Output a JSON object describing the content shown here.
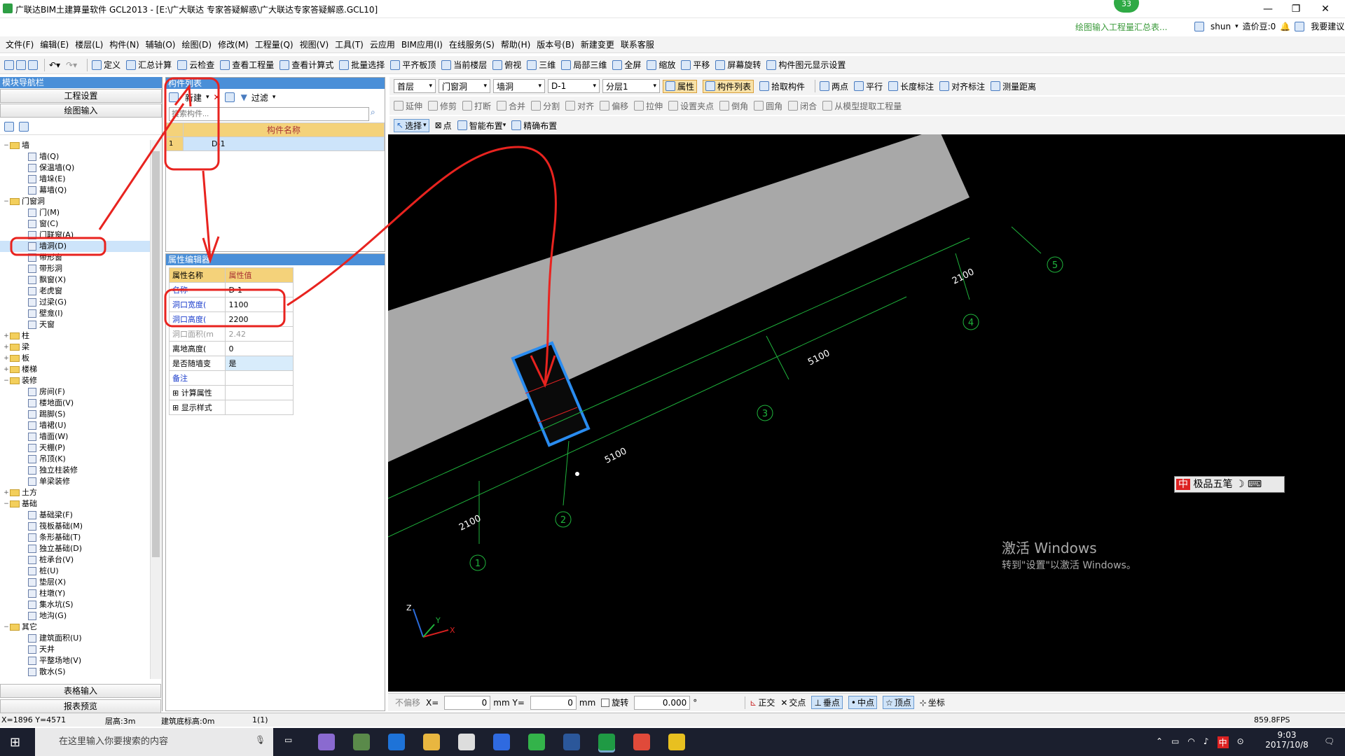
{
  "window": {
    "title": "广联达BIM土建算量软件 GCL2013 - [E:\\广大联达   专家答疑解惑\\广大联达专家答疑解惑.GCL10]",
    "notify_count": "33",
    "notify_text": "绘图输入工程量汇总表...",
    "user": "shun",
    "price_bean": "造价豆:0",
    "feedback": "我要建议"
  },
  "menu": [
    "文件(F)",
    "编辑(E)",
    "楼层(L)",
    "构件(N)",
    "辅轴(O)",
    "绘图(D)",
    "修改(M)",
    "工程量(Q)",
    "视图(V)",
    "工具(T)",
    "云应用",
    "BIM应用(I)",
    "在线服务(S)",
    "帮助(H)",
    "版本号(B)",
    "新建变更",
    "联系客服"
  ],
  "toolbar1": [
    "定义",
    "汇总计算",
    "云检查",
    "查看工程量",
    "查看计算式",
    "批量选择",
    "平齐板顶",
    "当前楼层",
    "俯视",
    "三维",
    "局部三维",
    "全屏",
    "缩放",
    "平移",
    "屏幕旋转",
    "构件图元显示设置"
  ],
  "nav": {
    "title": "模块导航栏",
    "btn_project": "工程设置",
    "btn_draw": "绘图输入",
    "btn_table": "表格输入",
    "btn_report": "报表预览",
    "tree": [
      {
        "label": "墙",
        "level": 0,
        "folder": true,
        "tog": "−"
      },
      {
        "label": "墙(Q)",
        "level": 1
      },
      {
        "label": "保温墙(Q)",
        "level": 1
      },
      {
        "label": "墙垛(E)",
        "level": 1
      },
      {
        "label": "幕墙(Q)",
        "level": 1
      },
      {
        "label": "门窗洞",
        "level": 0,
        "folder": true,
        "tog": "−"
      },
      {
        "label": "门(M)",
        "level": 1
      },
      {
        "label": "窗(C)",
        "level": 1
      },
      {
        "label": "门联窗(A)",
        "level": 1
      },
      {
        "label": "墙洞(D)",
        "level": 1
      },
      {
        "label": "带形窗",
        "level": 1
      },
      {
        "label": "带形洞",
        "level": 1
      },
      {
        "label": "飘窗(X)",
        "level": 1
      },
      {
        "label": "老虎窗",
        "level": 1
      },
      {
        "label": "过梁(G)",
        "level": 1
      },
      {
        "label": "壁龛(I)",
        "level": 1
      },
      {
        "label": "天窗",
        "level": 1
      },
      {
        "label": "柱",
        "level": 0,
        "folder": true,
        "tog": "+"
      },
      {
        "label": "梁",
        "level": 0,
        "folder": true,
        "tog": "+"
      },
      {
        "label": "板",
        "level": 0,
        "folder": true,
        "tog": "+"
      },
      {
        "label": "楼梯",
        "level": 0,
        "folder": true,
        "tog": "+"
      },
      {
        "label": "装修",
        "level": 0,
        "folder": true,
        "tog": "−"
      },
      {
        "label": "房间(F)",
        "level": 1
      },
      {
        "label": "楼地面(V)",
        "level": 1
      },
      {
        "label": "踢脚(S)",
        "level": 1
      },
      {
        "label": "墙裙(U)",
        "level": 1
      },
      {
        "label": "墙面(W)",
        "level": 1
      },
      {
        "label": "天棚(P)",
        "level": 1
      },
      {
        "label": "吊顶(K)",
        "level": 1
      },
      {
        "label": "独立柱装修",
        "level": 1
      },
      {
        "label": "单梁装修",
        "level": 1
      },
      {
        "label": "土方",
        "level": 0,
        "folder": true,
        "tog": "+"
      },
      {
        "label": "基础",
        "level": 0,
        "folder": true,
        "tog": "−"
      },
      {
        "label": "基础梁(F)",
        "level": 1
      },
      {
        "label": "筏板基础(M)",
        "level": 1
      },
      {
        "label": "条形基础(T)",
        "level": 1
      },
      {
        "label": "独立基础(D)",
        "level": 1
      },
      {
        "label": "桩承台(V)",
        "level": 1
      },
      {
        "label": "桩(U)",
        "level": 1
      },
      {
        "label": "垫层(X)",
        "level": 1
      },
      {
        "label": "柱墩(Y)",
        "level": 1
      },
      {
        "label": "集水坑(S)",
        "level": 1
      },
      {
        "label": "地沟(G)",
        "level": 1
      },
      {
        "label": "其它",
        "level": 0,
        "folder": true,
        "tog": "−"
      },
      {
        "label": "建筑面积(U)",
        "level": 1
      },
      {
        "label": "天井",
        "level": 1
      },
      {
        "label": "平整场地(V)",
        "level": 1
      },
      {
        "label": "散水(S)",
        "level": 1
      }
    ]
  },
  "complist": {
    "title": "构件列表",
    "new_btn": "新建",
    "filter_btn": "过滤",
    "search_placeholder": "搜索构件...",
    "col_name": "构件名称",
    "rows": [
      {
        "idx": "1",
        "name": "D-1"
      }
    ]
  },
  "propedit": {
    "title": "属性编辑器",
    "col_name": "属性名称",
    "col_value": "属性值",
    "rows": [
      {
        "name": "名称",
        "value": "D-1",
        "blue": true
      },
      {
        "name": "洞口宽度(",
        "value": "1100",
        "blue": true
      },
      {
        "name": "洞口高度(",
        "value": "2200",
        "blue": true
      },
      {
        "name": "洞口面积(m",
        "value": "2.42",
        "grey": true
      },
      {
        "name": "离地高度(",
        "value": "0"
      },
      {
        "name": "是否随墙变",
        "value": "是",
        "hl": true
      },
      {
        "name": "备注",
        "value": "",
        "blue": true
      },
      {
        "name": "计算属性",
        "value": "",
        "plus": true
      },
      {
        "name": "显示样式",
        "value": "",
        "plus": true
      }
    ]
  },
  "viewtb": {
    "floor": "首层",
    "type": "门窗洞",
    "sub": "墙洞",
    "comp": "D-1",
    "layer": "分层1",
    "attr": "属性",
    "comp_list": "构件列表",
    "pick": "拾取构件",
    "two_point": "两点",
    "parallel": "平行",
    "len_mark": "长度标注",
    "align_mark": "对齐标注",
    "measure": "测量距离",
    "row2": [
      "延伸",
      "修剪",
      "打断",
      "合并",
      "分割",
      "对齐",
      "偏移",
      "拉伸",
      "设置夹点",
      "倒角",
      "圆角",
      "闭合",
      "从模型提取工程量"
    ],
    "select": "选择",
    "point": "点",
    "smart": "智能布置",
    "precise": "精确布置"
  },
  "canvas": {
    "axes": [
      "1",
      "2",
      "3",
      "4",
      "5"
    ],
    "dims": [
      "2100",
      "5100",
      "5100",
      "2100"
    ],
    "activate_title": "激活 Windows",
    "activate_sub": "转到\"设置\"以激活 Windows。",
    "ime": "极品五笔",
    "z": "Z",
    "y": "Y",
    "x": "X"
  },
  "bottomtb": {
    "no_offset": "不偏移",
    "x": "X=",
    "xval": "0",
    "mm1": "mm Y=",
    "yval": "0",
    "mm2": "mm",
    "rotate": "旋转",
    "angle": "0.000",
    "deg": "°",
    "ortho": "正交",
    "cross": "交点",
    "perp": "垂点",
    "mid": "中点",
    "top": "顶点",
    "coord": "坐标"
  },
  "status": {
    "xy": "X=1896 Y=4571",
    "floor_h": "层高:3m",
    "base": "建筑底标高:0m",
    "count": "1(1)",
    "fps": "859.8FPS"
  },
  "taskbar": {
    "search": "在这里输入你要搜索的内容",
    "time": "9:03",
    "date": "2017/10/8"
  },
  "colors": {
    "accent": "#4a8fd8",
    "annotation": "#e8231f",
    "wall": "#a8a8a8",
    "axis": "#1fb43c"
  }
}
